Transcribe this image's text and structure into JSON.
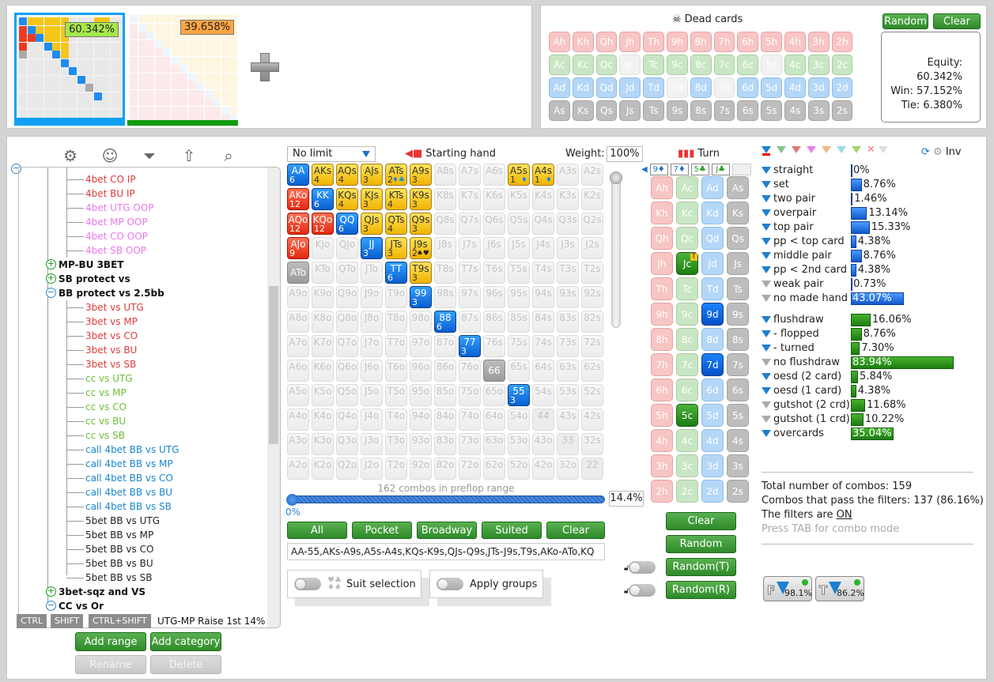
{
  "players": [
    {
      "equity": "60.342%",
      "badge_color": "#a6e84a",
      "bar_color": "#12a0f5",
      "selected": true
    },
    {
      "equity": "39.658%",
      "badge_color": "#ffa545",
      "bar_color": "#0e9a0e",
      "selected": false
    }
  ],
  "add_player_icon": "plus-icon",
  "dead_cards": {
    "title": "Dead cards",
    "icon": "skull-icon",
    "random_label": "Random",
    "clear_label": "Clear",
    "rows": [
      [
        "Ah",
        "Kh",
        "Qh",
        "Jh",
        "Th",
        "9h",
        "8h",
        "7h",
        "6h",
        "5h",
        "4h",
        "3h",
        "2h"
      ],
      [
        "Ac",
        "Kc",
        "Qc",
        "Jc",
        "Tc",
        "9c",
        "8c",
        "7c",
        "6c",
        "5c",
        "4c",
        "3c",
        "2c"
      ],
      [
        "Ad",
        "Kd",
        "Qd",
        "Jd",
        "Td",
        "9d",
        "8d",
        "7d",
        "6d",
        "5d",
        "4d",
        "3d",
        "2d"
      ],
      [
        "As",
        "Ks",
        "Qs",
        "Js",
        "Ts",
        "9s",
        "8s",
        "7s",
        "6s",
        "5s",
        "4s",
        "3s",
        "2s"
      ]
    ],
    "unavailable": [
      "Jc",
      "5c",
      "9d",
      "7d"
    ]
  },
  "results": {
    "equity": "Equity: 60.342%",
    "win": "Win: 57.152%",
    "tie": "Tie: 6.380%"
  },
  "toolbar_icons": [
    "gear-icon",
    "user-icon",
    "filter-icon",
    "export-icon",
    "search-icon"
  ],
  "tree": {
    "nodes": [
      {
        "label": "4bet CO IP",
        "color": "#e03a3a",
        "level": 2
      },
      {
        "label": "4bet BU IP",
        "color": "#e03a3a",
        "level": 2
      },
      {
        "label": "4bet UTG OOP",
        "color": "#ee77ee",
        "level": 2
      },
      {
        "label": "4bet MP OOP",
        "color": "#ee77ee",
        "level": 2
      },
      {
        "label": "4bet CO OOP",
        "color": "#ee77ee",
        "level": 2
      },
      {
        "label": "4bet SB OOP",
        "color": "#ee77ee",
        "level": 2
      },
      {
        "label": "MP-BU 3BET",
        "color": "#111111",
        "level": 1,
        "toggle": "plus"
      },
      {
        "label": "SB protect vs",
        "color": "#111111",
        "level": 1,
        "toggle": "plus"
      },
      {
        "label": "BB protect vs 2.5bb",
        "color": "#111111",
        "level": 1,
        "toggle": "minus"
      },
      {
        "label": "3bet vs UTG",
        "color": "#e03a3a",
        "level": 2
      },
      {
        "label": "3bet vs MP",
        "color": "#e03a3a",
        "level": 2
      },
      {
        "label": "3bet vs CO",
        "color": "#e03a3a",
        "level": 2
      },
      {
        "label": "3bet vs BU",
        "color": "#e03a3a",
        "level": 2
      },
      {
        "label": "3bet vs SB",
        "color": "#e03a3a",
        "level": 2
      },
      {
        "label": "cc vs UTG",
        "color": "#6cbf3a",
        "level": 2
      },
      {
        "label": "cc vs MP",
        "color": "#6cbf3a",
        "level": 2
      },
      {
        "label": "cc vs CO",
        "color": "#6cbf3a",
        "level": 2
      },
      {
        "label": "cc vs BU",
        "color": "#6cbf3a",
        "level": 2
      },
      {
        "label": "cc vs SB",
        "color": "#6cbf3a",
        "level": 2
      },
      {
        "label": "call 4bet BB vs UTG",
        "color": "#1a86d0",
        "level": 2
      },
      {
        "label": "call 4bet BB vs MP",
        "color": "#1a86d0",
        "level": 2
      },
      {
        "label": "call 4bet BB vs CO",
        "color": "#1a86d0",
        "level": 2
      },
      {
        "label": "call 4bet BB vs BU",
        "color": "#1a86d0",
        "level": 2
      },
      {
        "label": "call 4bet BB vs SB",
        "color": "#1a86d0",
        "level": 2
      },
      {
        "label": "5bet BB vs UTG",
        "color": "#222222",
        "level": 2
      },
      {
        "label": "5bet BB vs MP",
        "color": "#222222",
        "level": 2
      },
      {
        "label": "5bet BB vs CO",
        "color": "#222222",
        "level": 2
      },
      {
        "label": "5bet BB vs BU",
        "color": "#222222",
        "level": 2
      },
      {
        "label": "5bet BB vs SB",
        "color": "#222222",
        "level": 2
      },
      {
        "label": "3bet-sqz and VS",
        "color": "#111111",
        "level": 1,
        "toggle": "plus"
      },
      {
        "label": "CC vs Or",
        "color": "#111111",
        "level": 1,
        "toggle": "minus"
      }
    ],
    "partial_item": "UTG-MP Raise 1st 14%",
    "keys": [
      "CTRL",
      "SHIFT",
      "CTRL+SHIFT"
    ],
    "add_range": "Add range",
    "add_category": "Add category",
    "rename": "Rename",
    "delete": "Delete"
  },
  "range": {
    "limit_select": "No limit",
    "starting_hand_label": "Starting hand",
    "weight_label": "Weight:",
    "weight_value": "100%",
    "combos_label": "162 combos in preflop range",
    "slider_min_label": "0%",
    "slider_value": "14.4%",
    "buttons": [
      "All",
      "Pocket",
      "Broadway",
      "Suited",
      "Clear"
    ],
    "range_text": "AA-55,AKs-A9s,A5s-A4s,KQs-K9s,QJs-Q9s,JTs-J9s,T9s,AKo-ATo,KQ",
    "suit_selection_label": "Suit selection",
    "apply_groups_label": "Apply groups",
    "highlighted": {
      "AA": {
        "style": "blue",
        "n": "6"
      },
      "AKs": {
        "style": "yel",
        "n": "4"
      },
      "AQs": {
        "style": "yel",
        "n": "4"
      },
      "AJs": {
        "style": "yel",
        "n": "3"
      },
      "ATs": {
        "style": "yel",
        "n": "2",
        "suits": "♦♣"
      },
      "A9s": {
        "style": "yel",
        "n": "3"
      },
      "A5s": {
        "style": "yel",
        "n": "1",
        "suits": "♦"
      },
      "A4s": {
        "style": "yel",
        "n": "1",
        "suits": "♦"
      },
      "AKo": {
        "style": "red",
        "n": "12"
      },
      "KK": {
        "style": "blue",
        "n": "6"
      },
      "KQs": {
        "style": "yel",
        "n": "4"
      },
      "KJs": {
        "style": "yel",
        "n": "3"
      },
      "KTs": {
        "style": "yel",
        "n": "4"
      },
      "K9s": {
        "style": "yel",
        "n": "3"
      },
      "AQo": {
        "style": "red",
        "n": "12"
      },
      "KQo": {
        "style": "red",
        "n": "12"
      },
      "QQ": {
        "style": "blue",
        "n": "6"
      },
      "QJs": {
        "style": "yel",
        "n": "3"
      },
      "QTs": {
        "style": "yel",
        "n": "4"
      },
      "Q9s": {
        "style": "yel",
        "n": "3"
      },
      "AJo": {
        "style": "red",
        "n": "9"
      },
      "JJ": {
        "style": "blue",
        "n": "3"
      },
      "JTs": {
        "style": "yel",
        "n": "3"
      },
      "J9s": {
        "style": "yel",
        "n": "2",
        "suits": "♠♥"
      },
      "ATo": {
        "style": "gry",
        "n": ""
      },
      "TT": {
        "style": "blue",
        "n": "6"
      },
      "T9s": {
        "style": "yel",
        "n": "3"
      },
      "99": {
        "style": "blue",
        "n": "3"
      },
      "88": {
        "style": "blue",
        "n": "6"
      },
      "77": {
        "style": "blue",
        "n": "3"
      },
      "66": {
        "style": "gry",
        "n": ""
      },
      "55": {
        "style": "blue",
        "n": "3"
      }
    }
  },
  "board": {
    "title": "Turn",
    "cards": [
      "9♦",
      "7♦",
      "5♣",
      "J♣",
      ""
    ],
    "selected": {
      "Jc": "green",
      "5c": "green",
      "9d": "blue",
      "7d": "blue"
    },
    "turn_marker": "T",
    "clear": "Clear",
    "random": "Random",
    "random_t": "Random(T)",
    "random_r": "Random(R)"
  },
  "filters": {
    "inv_label": "Inv",
    "made_hands": [
      {
        "label": "straight",
        "pct": "0%",
        "value": 0,
        "active": true
      },
      {
        "label": "set",
        "pct": "8.76%",
        "value": 8.76,
        "active": true
      },
      {
        "label": "two pair",
        "pct": "1.46%",
        "value": 1.46,
        "active": true
      },
      {
        "label": "overpair",
        "pct": "13.14%",
        "value": 13.14,
        "active": true
      },
      {
        "label": "top pair",
        "pct": "15.33%",
        "value": 15.33,
        "active": true
      },
      {
        "label": "pp < top card",
        "pct": "4.38%",
        "value": 4.38,
        "active": true
      },
      {
        "label": "middle pair",
        "pct": "8.76%",
        "value": 8.76,
        "active": true
      },
      {
        "label": "pp < 2nd card",
        "pct": "4.38%",
        "value": 4.38,
        "active": true
      },
      {
        "label": "weak pair",
        "pct": "0.73%",
        "value": 0.73,
        "active": false
      },
      {
        "label": "no made hand",
        "pct": "43.07%",
        "value": 43.07,
        "active": false
      }
    ],
    "draws": [
      {
        "label": "flushdraw",
        "pct": "16.06%",
        "value": 16.06,
        "active": true
      },
      {
        "label": "- flopped",
        "pct": "8.76%",
        "value": 8.76,
        "active": true
      },
      {
        "label": "- turned",
        "pct": "7.30%",
        "value": 7.3,
        "active": true
      },
      {
        "label": "no flushdraw",
        "pct": "83.94%",
        "value": 83.94,
        "active": false
      },
      {
        "label": "oesd (2 card)",
        "pct": "5.84%",
        "value": 5.84,
        "active": true
      },
      {
        "label": "oesd (1 card)",
        "pct": "4.38%",
        "value": 4.38,
        "active": true
      },
      {
        "label": "gutshot (2 crd)",
        "pct": "11.68%",
        "value": 11.68,
        "active": false
      },
      {
        "label": "gutshot (1 crd)",
        "pct": "10.22%",
        "value": 10.22,
        "active": false
      },
      {
        "label": "overcards",
        "pct": "35.04%",
        "value": 35.04,
        "active": true
      }
    ],
    "total_combos": "Total number of combos: 159",
    "pass_combos": "Combos that pass the filters: 137 (86.16%)",
    "filters_on_prefix": "The filters are ",
    "filters_on_value": "ON",
    "tab_hint": "Press TAB for combo mode",
    "flop_badge": {
      "letter": "F",
      "pct": "98.1%"
    },
    "turn_badge": {
      "letter": "T",
      "pct": "86.2%"
    }
  }
}
